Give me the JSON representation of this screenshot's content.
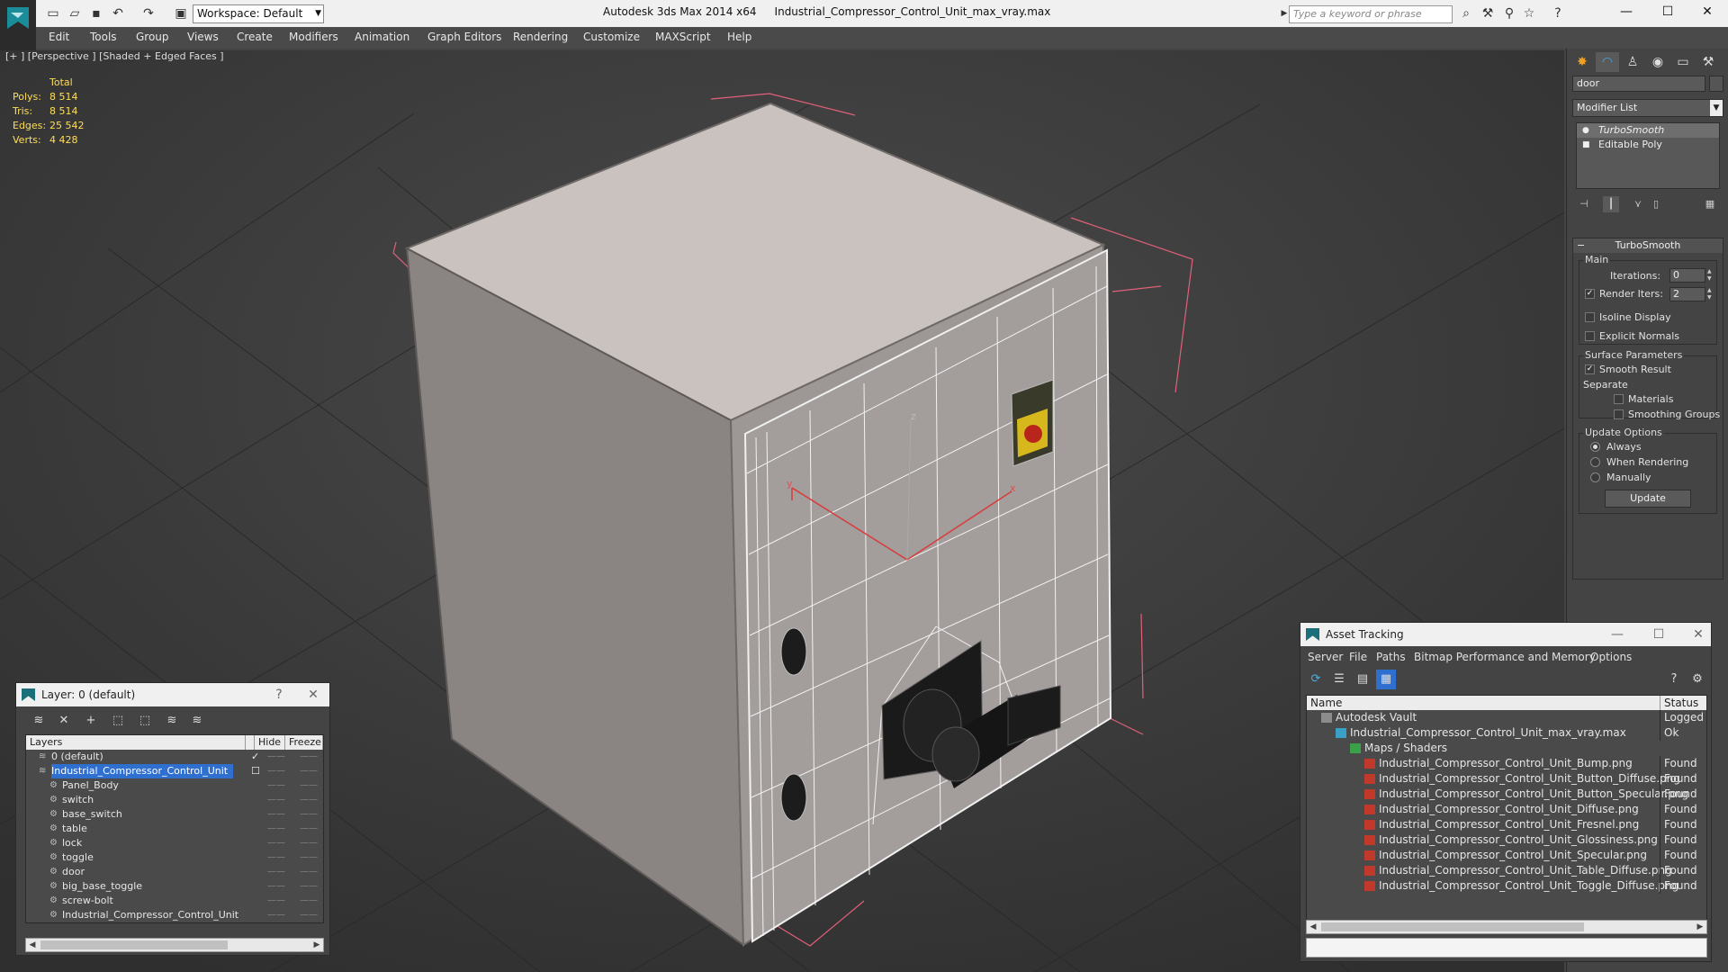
{
  "titlebar": {
    "app": "Autodesk 3ds Max  2014 x64",
    "file": "Industrial_Compressor_Control_Unit_max_vray.max",
    "workspace": "Workspace: Default",
    "search_placeholder": "Type a keyword or phrase"
  },
  "menu": [
    "Edit",
    "Tools",
    "Group",
    "Views",
    "Create",
    "Modifiers",
    "Animation",
    "Graph Editors",
    "Rendering",
    "Customize",
    "MAXScript",
    "Help"
  ],
  "viewport": {
    "label": "[+ ] [Perspective ] [Shaded + Edged Faces ]",
    "stats": {
      "header": "Total",
      "rows": [
        {
          "k": "Polys:",
          "v": "8 514"
        },
        {
          "k": "Tris:",
          "v": "8 514"
        },
        {
          "k": "Edges:",
          "v": "25 542"
        },
        {
          "k": "Verts:",
          "v": "4 428"
        }
      ]
    },
    "axis_labels": {
      "z": "z",
      "y": "y",
      "x": "x"
    }
  },
  "command_panel": {
    "object_name": "door",
    "modifier_list": "Modifier List",
    "stack": [
      "TurboSmooth",
      "Editable Poly"
    ],
    "rollout_title": "TurboSmooth",
    "main_group": "Main",
    "iterations_label": "Iterations:",
    "iterations_value": "0",
    "render_iters_label": "Render Iters:",
    "render_iters_value": "2",
    "render_iters_checked": true,
    "isoline_display": "Isoline Display",
    "explicit_normals": "Explicit Normals",
    "surface_group": "Surface Parameters",
    "smooth_result": "Smooth Result",
    "separate_label": "Separate",
    "materials": "Materials",
    "smoothing_groups": "Smoothing Groups",
    "update_group": "Update Options",
    "always": "Always",
    "when_rendering": "When Rendering",
    "manually": "Manually",
    "update_button": "Update"
  },
  "layer_dialog": {
    "title": "Layer: 0 (default)",
    "columns": [
      "Layers",
      "Hide",
      "Freeze"
    ],
    "rows": [
      {
        "name": "0 (default)",
        "level": 0,
        "type": "layer",
        "current": true
      },
      {
        "name": "Industrial_Compressor_Control_Unit",
        "level": 0,
        "type": "layer",
        "selected": true
      },
      {
        "name": "Panel_Body",
        "level": 1,
        "type": "object"
      },
      {
        "name": "switch",
        "level": 1,
        "type": "object"
      },
      {
        "name": "base_switch",
        "level": 1,
        "type": "object"
      },
      {
        "name": "table",
        "level": 1,
        "type": "object"
      },
      {
        "name": "lock",
        "level": 1,
        "type": "object"
      },
      {
        "name": "toggle",
        "level": 1,
        "type": "object"
      },
      {
        "name": "door",
        "level": 1,
        "type": "object"
      },
      {
        "name": "big_base_toggle",
        "level": 1,
        "type": "object"
      },
      {
        "name": "screw-bolt",
        "level": 1,
        "type": "object"
      },
      {
        "name": "Industrial_Compressor_Control_Unit",
        "level": 1,
        "type": "object"
      }
    ]
  },
  "asset_dialog": {
    "title": "Asset Tracking",
    "menu": [
      "Server",
      "File",
      "Paths",
      "Bitmap Performance and Memory",
      "Options"
    ],
    "columns": [
      "Name",
      "Status"
    ],
    "rows": [
      {
        "name": "Autodesk Vault",
        "status": "Logged Out",
        "level": 0,
        "icon": "vault"
      },
      {
        "name": "Industrial_Compressor_Control_Unit_max_vray.max",
        "status": "Ok",
        "level": 1,
        "icon": "max"
      },
      {
        "name": "Maps / Shaders",
        "status": "",
        "level": 2,
        "icon": "maps"
      },
      {
        "name": "Industrial_Compressor_Control_Unit_Bump.png",
        "status": "Found",
        "level": 3,
        "icon": "png"
      },
      {
        "name": "Industrial_Compressor_Control_Unit_Button_Diffuse.png",
        "status": "Found",
        "level": 3,
        "icon": "png"
      },
      {
        "name": "Industrial_Compressor_Control_Unit_Button_Specular.png",
        "status": "Found",
        "level": 3,
        "icon": "png"
      },
      {
        "name": "Industrial_Compressor_Control_Unit_Diffuse.png",
        "status": "Found",
        "level": 3,
        "icon": "png"
      },
      {
        "name": "Industrial_Compressor_Control_Unit_Fresnel.png",
        "status": "Found",
        "level": 3,
        "icon": "png"
      },
      {
        "name": "Industrial_Compressor_Control_Unit_Glossiness.png",
        "status": "Found",
        "level": 3,
        "icon": "png"
      },
      {
        "name": "Industrial_Compressor_Control_Unit_Specular.png",
        "status": "Found",
        "level": 3,
        "icon": "png"
      },
      {
        "name": "Industrial_Compressor_Control_Unit_Table_Diffuse.png",
        "status": "Found",
        "level": 3,
        "icon": "png"
      },
      {
        "name": "Industrial_Compressor_Control_Unit_Toggle_Diffuse.png",
        "status": "Found",
        "level": 3,
        "icon": "png"
      }
    ]
  },
  "colors": {
    "stats": "#ffde57",
    "selection": "#2e6fd0",
    "bbox": "#e0607a",
    "axis": "#d93a3a",
    "box_top": "#c9c2be",
    "box_front": "#9b9593",
    "box_side": "#8a8482"
  }
}
